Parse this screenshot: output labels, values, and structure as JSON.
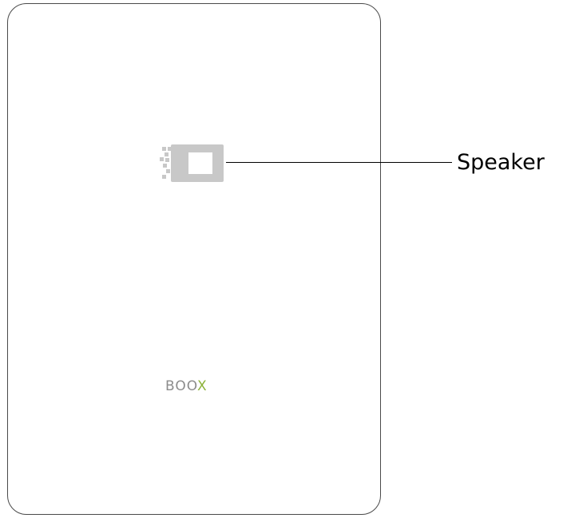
{
  "callouts": [
    {
      "label": "Speaker"
    }
  ],
  "logo": {
    "text_main": "BOO",
    "text_accent": "X",
    "text_color": "#8c8c8c",
    "accent_color": "#8db23a"
  },
  "colors": {
    "outline": "#4a4a4a",
    "speaker": "#c8c8c8",
    "leader_line": "#000000"
  }
}
